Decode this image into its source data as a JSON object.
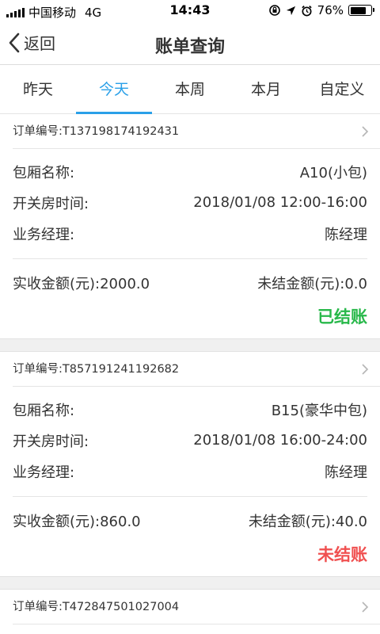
{
  "status_bar": {
    "carrier": "中国移动",
    "network": "4G",
    "time": "14:43",
    "battery_percent": "76%",
    "battery_level": 0.76
  },
  "nav": {
    "back_label": "返回",
    "title": "账单查询"
  },
  "tabs": [
    {
      "label": "昨天",
      "active": false
    },
    {
      "label": "今天",
      "active": true
    },
    {
      "label": "本周",
      "active": false
    },
    {
      "label": "本月",
      "active": false
    },
    {
      "label": "自定义",
      "active": false
    }
  ],
  "labels": {
    "room_name": "包厢名称:",
    "open_close_time": "开关房时间:",
    "manager": "业务经理:"
  },
  "orders": [
    {
      "order_no": "订单编号:T137198174192431",
      "room": "A10(小包)",
      "time": "2018/01/08 12:00-16:00",
      "manager": "陈经理",
      "received": "实收金额(元):2000.0",
      "unsettled": "未结金额(元):0.0",
      "status": "已结账",
      "status_color": "#28b84a"
    },
    {
      "order_no": "订单编号:T857191241192682",
      "room": "B15(豪华中包)",
      "time": "2018/01/08 16:00-24:00",
      "manager": "陈经理",
      "received": "实收金额(元):860.0",
      "unsettled": "未结金额(元):40.0",
      "status": "未结账",
      "status_color": "#f05050"
    },
    {
      "order_no": "订单编号:T472847501027004"
    }
  ],
  "colors": {
    "accent": "#2aa0e8",
    "paid": "#28b84a",
    "unpaid": "#f05050"
  }
}
